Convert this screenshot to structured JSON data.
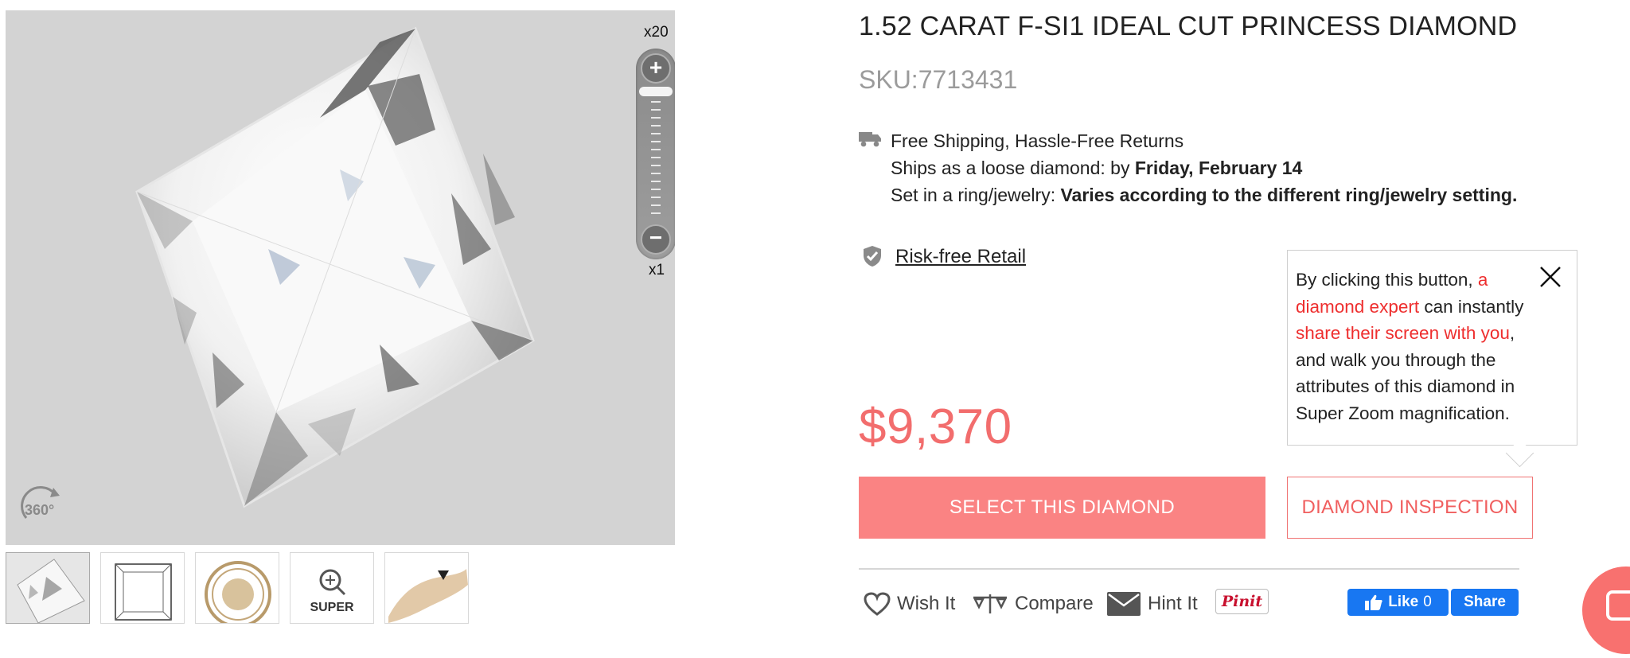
{
  "product": {
    "title": "1.52 CARAT F-SI1 IDEAL CUT PRINCESS DIAMOND",
    "sku": "SKU:7713431",
    "price": "$9,370"
  },
  "viewer": {
    "zoom_max": "x20",
    "zoom_min": "x1",
    "rotate_label": "360°",
    "zoom_in": "+",
    "zoom_out": "−"
  },
  "thumbnails": [
    {
      "icon": "diamond-photo-icon"
    },
    {
      "icon": "diagram-icon"
    },
    {
      "icon": "gia-seal-icon"
    },
    {
      "icon": "magnifier-icon",
      "label": "SUPER"
    },
    {
      "icon": "hand-ring-icon"
    }
  ],
  "shipping": {
    "line1": "Free Shipping, Hassle-Free Returns",
    "line2_prefix": "Ships as a loose diamond: by ",
    "line2_bold": "Friday, February 14",
    "line3_prefix": "Set in a ring/jewelry: ",
    "line3_bold": "Varies according to the different ring/jewelry setting."
  },
  "risk_free": " Risk-free Retail",
  "tooltip": {
    "t1": "By clicking this button, ",
    "t2": "a diamond expert",
    "t3": " can instantly ",
    "t4": "share their screen with you",
    "t5": ", and walk you through the attributes of this diamond in Super Zoom magnification."
  },
  "buttons": {
    "select": "SELECT THIS DIAMOND",
    "inspect": "DIAMOND INSPECTION"
  },
  "actions": {
    "wish": "Wish It",
    "compare": "Compare",
    "hint": "Hint It",
    "pin": "Pinit",
    "fb_like": "Like",
    "fb_count": "0",
    "fb_share": "Share"
  },
  "colors": {
    "accent": "#fa8383",
    "price": "#f26d6d",
    "tooltip_highlight": "#ee2e2e",
    "facebook": "#1877f2"
  }
}
